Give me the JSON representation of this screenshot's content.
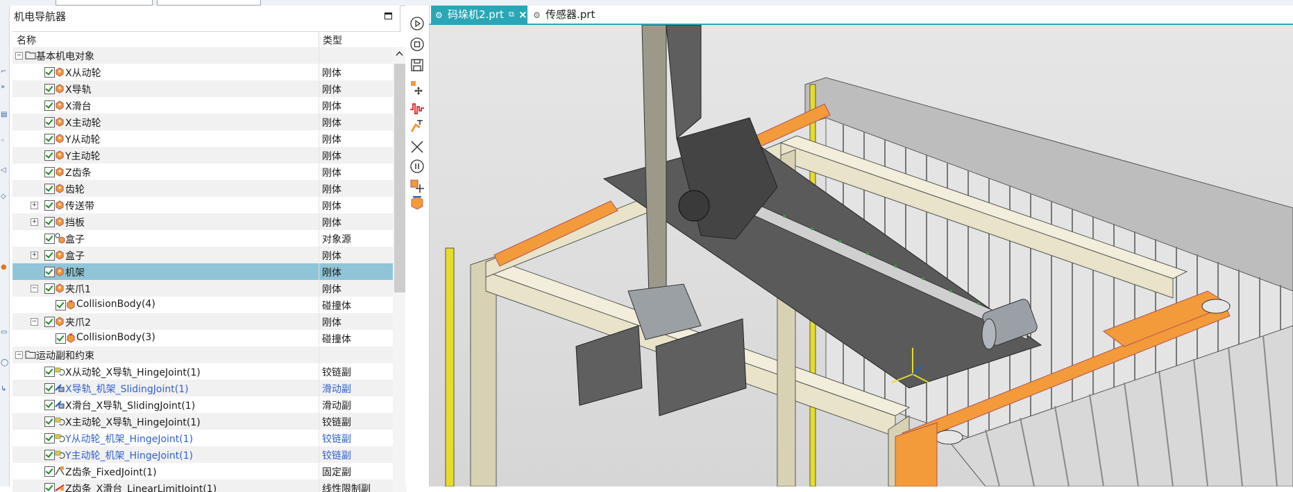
{
  "navigator": {
    "title": "机电导航器",
    "col_name": "名称",
    "col_type": "类型",
    "rows": [
      {
        "name": "基本机电对象",
        "type": "",
        "level": 0,
        "expand": "-",
        "icon": "folder-icon",
        "check": false
      },
      {
        "name": "X从动轮",
        "type": "刚体",
        "level": 1,
        "expand": "",
        "icon": "rigid-body-icon",
        "check": true
      },
      {
        "name": "X导轨",
        "type": "刚体",
        "level": 1,
        "expand": "",
        "icon": "rigid-body-icon",
        "check": true
      },
      {
        "name": "X滑台",
        "type": "刚体",
        "level": 1,
        "expand": "",
        "icon": "rigid-body-icon",
        "check": true
      },
      {
        "name": "X主动轮",
        "type": "刚体",
        "level": 1,
        "expand": "",
        "icon": "rigid-body-icon",
        "check": true
      },
      {
        "name": "Y从动轮",
        "type": "刚体",
        "level": 1,
        "expand": "",
        "icon": "rigid-body-icon",
        "check": true
      },
      {
        "name": "Y主动轮",
        "type": "刚体",
        "level": 1,
        "expand": "",
        "icon": "rigid-body-icon",
        "check": true
      },
      {
        "name": "Z齿条",
        "type": "刚体",
        "level": 1,
        "expand": "",
        "icon": "rigid-body-icon",
        "check": true
      },
      {
        "name": "齿轮",
        "type": "刚体",
        "level": 1,
        "expand": "",
        "icon": "rigid-body-icon",
        "check": true
      },
      {
        "name": "传送带",
        "type": "刚体",
        "level": 1,
        "expand": "+",
        "icon": "rigid-body-icon",
        "check": true
      },
      {
        "name": "挡板",
        "type": "刚体",
        "level": 1,
        "expand": "+",
        "icon": "rigid-body-icon",
        "check": true
      },
      {
        "name": "盒子",
        "type": "对象源",
        "level": 1,
        "expand": "",
        "icon": "object-source-icon",
        "check": true
      },
      {
        "name": "盒子",
        "type": "刚体",
        "level": 1,
        "expand": "+",
        "icon": "rigid-body-icon",
        "check": true
      },
      {
        "name": "机架",
        "type": "刚体",
        "level": 1,
        "expand": "",
        "icon": "rigid-body-icon",
        "check": true,
        "selected": true
      },
      {
        "name": "夹爪1",
        "type": "刚体",
        "level": 1,
        "expand": "-",
        "icon": "rigid-body-icon",
        "check": true
      },
      {
        "name": "CollisionBody(4)",
        "type": "碰撞体",
        "level": 2,
        "expand": "",
        "icon": "collision-body-icon",
        "check": true
      },
      {
        "name": "夹爪2",
        "type": "刚体",
        "level": 1,
        "expand": "-",
        "icon": "rigid-body-icon",
        "check": true
      },
      {
        "name": "CollisionBody(3)",
        "type": "碰撞体",
        "level": 2,
        "expand": "",
        "icon": "collision-body-icon",
        "check": true
      },
      {
        "name": "运动副和约束",
        "type": "",
        "level": 0,
        "expand": "-",
        "icon": "folder-icon",
        "check": false
      },
      {
        "name": "X从动轮_X导轨_HingeJoint(1)",
        "type": "铰链副",
        "level": 1,
        "expand": "",
        "icon": "hinge-joint-icon",
        "check": true
      },
      {
        "name": "X导轨_机架_SlidingJoint(1)",
        "type": "滑动副",
        "level": 1,
        "expand": "",
        "icon": "sliding-joint-icon",
        "check": true,
        "blue": true
      },
      {
        "name": "X滑台_X导轨_SlidingJoint(1)",
        "type": "滑动副",
        "level": 1,
        "expand": "",
        "icon": "sliding-joint-icon",
        "check": true
      },
      {
        "name": "X主动轮_X导轨_HingeJoint(1)",
        "type": "铰链副",
        "level": 1,
        "expand": "",
        "icon": "hinge-joint-icon",
        "check": true
      },
      {
        "name": "Y从动轮_机架_HingeJoint(1)",
        "type": "铰链副",
        "level": 1,
        "expand": "",
        "icon": "hinge-joint-icon",
        "check": true,
        "blue": true
      },
      {
        "name": "Y主动轮_机架_HingeJoint(1)",
        "type": "铰链副",
        "level": 1,
        "expand": "",
        "icon": "hinge-joint-icon",
        "check": true,
        "blue": true
      },
      {
        "name": "Z齿条_FixedJoint(1)",
        "type": "固定副",
        "level": 1,
        "expand": "",
        "icon": "fixed-joint-icon",
        "check": true
      },
      {
        "name": "Z齿条_X滑台_LinearLimitJoint(1)",
        "type": "线性限制副",
        "level": 1,
        "expand": "",
        "icon": "limit-joint-icon",
        "check": true
      }
    ]
  },
  "tabs": [
    {
      "label": "码垛机2.prt",
      "active": true
    },
    {
      "label": "传感器.prt",
      "active": false
    }
  ],
  "colors": {
    "accent": "#2aa7b6",
    "selected_row": "#8fc5d6",
    "link_blue": "#2f5fcf",
    "orange": "#f39a3a"
  }
}
